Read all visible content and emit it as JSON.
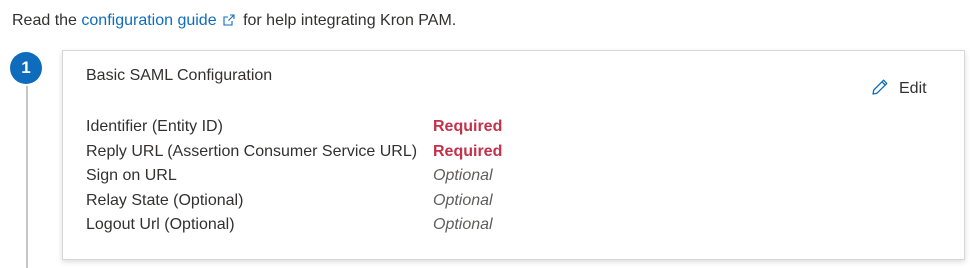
{
  "intro": {
    "prefix": "Read the",
    "link": "configuration guide",
    "suffix": "for help integrating Kron PAM."
  },
  "step": {
    "number": "1"
  },
  "card": {
    "title": "Basic SAML Configuration",
    "edit_label": "Edit",
    "fields": [
      {
        "label": "Identifier (Entity ID)",
        "value": "Required"
      },
      {
        "label": "Reply URL (Assertion Consumer Service URL)",
        "value": "Required"
      },
      {
        "label": "Sign on URL",
        "value": "Optional"
      },
      {
        "label": "Relay State (Optional)",
        "value": "Optional"
      },
      {
        "label": "Logout Url (Optional)",
        "value": "Optional"
      }
    ]
  },
  "colors": {
    "link": "#0f6cbd",
    "step_badge": "#0f6cbd",
    "required": "#c4314b",
    "optional": "#605e5c"
  },
  "icons": {
    "external": "external-link-icon",
    "edit": "pencil-icon"
  }
}
